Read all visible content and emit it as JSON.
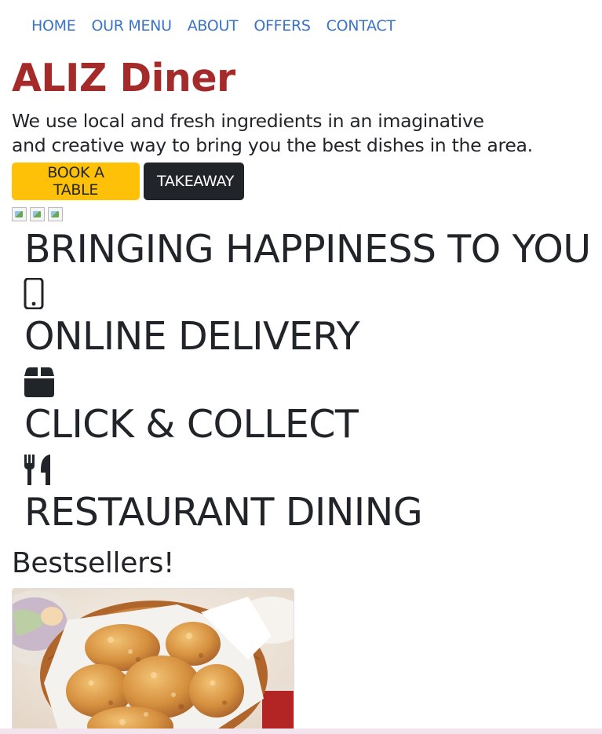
{
  "nav": {
    "items": [
      "HOME",
      "OUR MENU",
      "ABOUT",
      "OFFERS",
      "CONTACT"
    ]
  },
  "header": {
    "brand": "ALIZ Diner",
    "tagline_line1": "We use local and fresh ingredients in an imaginative",
    "tagline_line2": "and creative way to bring you the best dishes in the area."
  },
  "actions": {
    "book_label": "BOOK A TABLE",
    "takeaway_label": "TAKEAWAY"
  },
  "features": {
    "title": "BRINGING HAPPINESS TO YOU",
    "items": [
      {
        "icon": "phone-icon",
        "label": "ONLINE DELIVERY"
      },
      {
        "icon": "box-icon",
        "label": "CLICK & COLLECT"
      },
      {
        "icon": "utensils-icon",
        "label": "RESTAURANT DINING"
      }
    ]
  },
  "bestsellers": {
    "title": "Bestsellers!"
  },
  "colors": {
    "nav_link": "#3a73c9",
    "brand": "#a52a2a",
    "book_button": "#ffc107",
    "takeaway_button": "#212529",
    "text": "#212529"
  }
}
